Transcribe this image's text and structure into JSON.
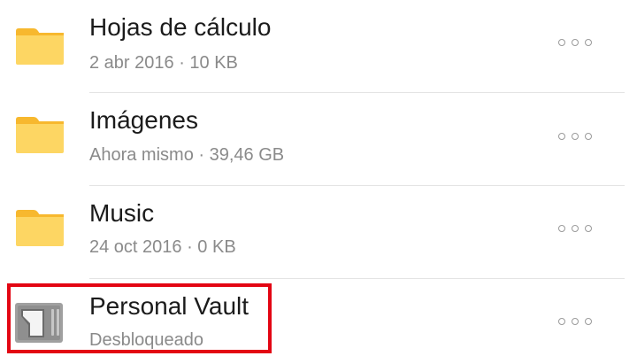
{
  "colors": {
    "folder_body": "#FDD663",
    "folder_tab": "#F7B82E",
    "title_text": "#1b1b1b",
    "meta_text": "#8a8a8a",
    "divider": "#e4e4e4",
    "highlight_border": "#e30613",
    "vault_icon": "#a0a0a0"
  },
  "items": [
    {
      "icon": "folder-icon",
      "name": "Hojas de cálculo",
      "meta": "2 abr 2016 · 10 KB"
    },
    {
      "icon": "folder-icon",
      "name": "Imágenes",
      "meta": "Ahora mismo · 39,46 GB"
    },
    {
      "icon": "folder-icon",
      "name": "Music",
      "meta": "24 oct 2016 · 0 KB"
    },
    {
      "icon": "personal-vault-icon",
      "name": "Personal Vault",
      "meta": "Desbloqueado",
      "highlighted": true
    }
  ]
}
